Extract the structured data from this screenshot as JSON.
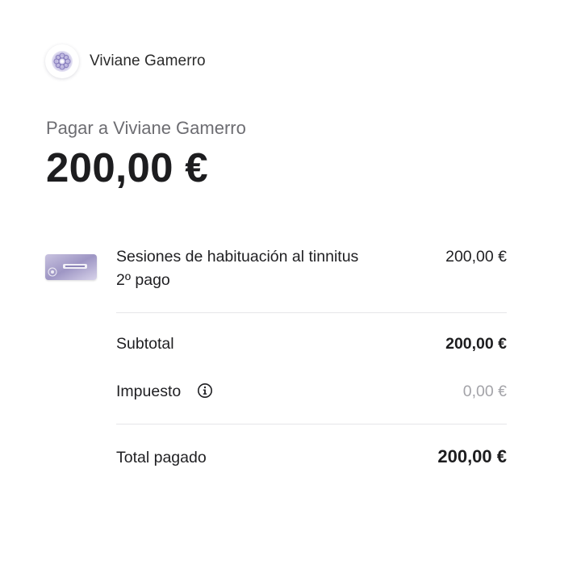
{
  "merchant": {
    "name": "Viviane Gamerro",
    "logo_icon": "mandala-icon"
  },
  "header": {
    "pay_to": "Pagar a Viviane Gamerro",
    "amount": "200,00 €"
  },
  "line_item": {
    "name_line1": "Sesiones de habituación al tinnitus",
    "name_line2": "2º pago",
    "price": "200,00 €",
    "thumbnail_icon": "product-thumbnail"
  },
  "totals": {
    "subtotal_label": "Subtotal",
    "subtotal_value": "200,00 €",
    "tax_label": "Impuesto",
    "tax_value": "0,00 €",
    "tax_info_icon": "info-icon",
    "total_label": "Total pagado",
    "total_value": "200,00 €"
  },
  "colors": {
    "text": "#1d1d1f",
    "muted": "#6d6d72",
    "divider": "#e6e6e9"
  }
}
